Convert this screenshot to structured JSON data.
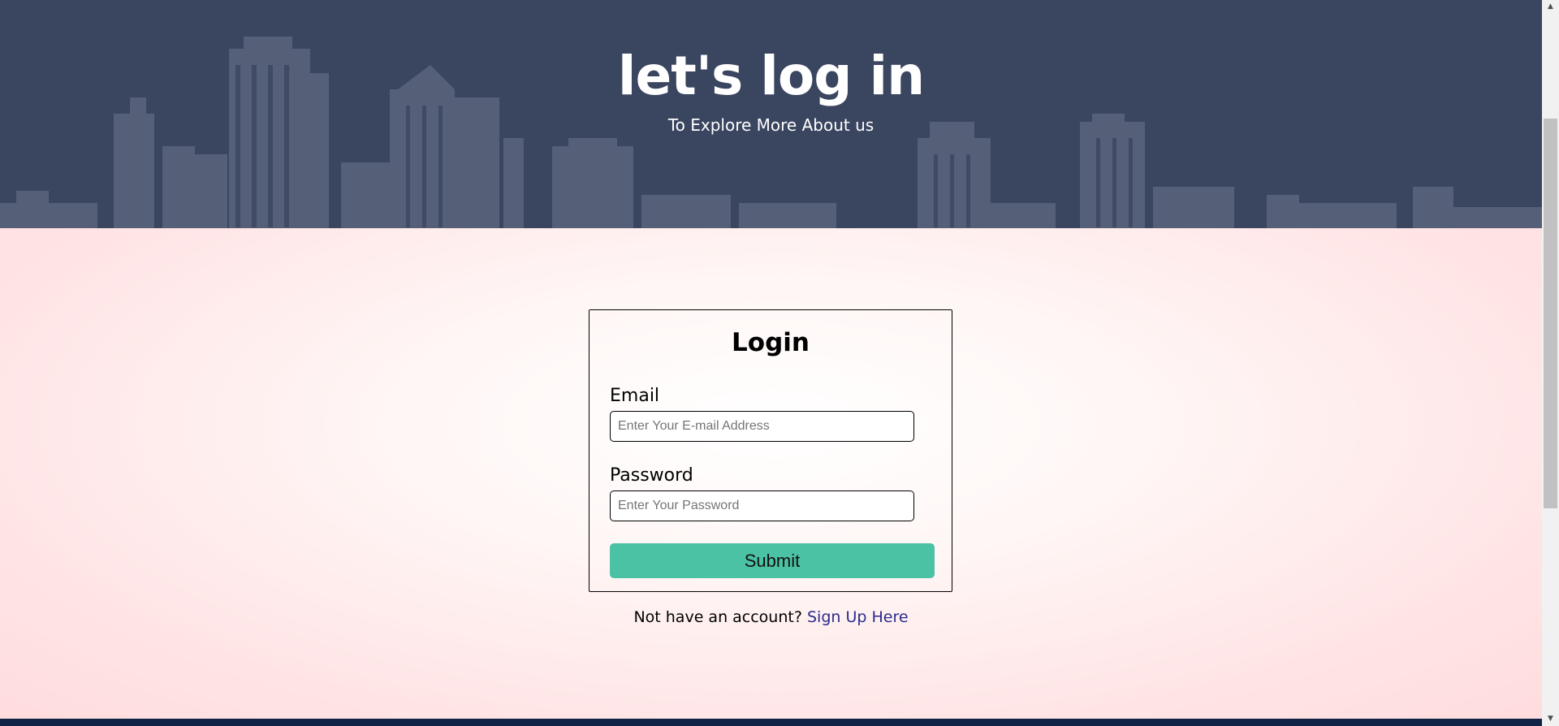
{
  "hero": {
    "title": "let's log in",
    "subtitle": "To Explore More About us"
  },
  "login": {
    "title": "Login",
    "email_label": "Email",
    "email_placeholder": "Enter Your E-mail Address",
    "password_label": "Password",
    "password_placeholder": "Enter Your Password",
    "submit_label": "Submit"
  },
  "signup": {
    "prompt": "Not have an account?",
    "link": "Sign Up Here"
  },
  "colors": {
    "hero_bg": "#3a4560",
    "submit_bg": "#4cc2a5",
    "link": "#2b2b8c",
    "footer": "#102346"
  }
}
